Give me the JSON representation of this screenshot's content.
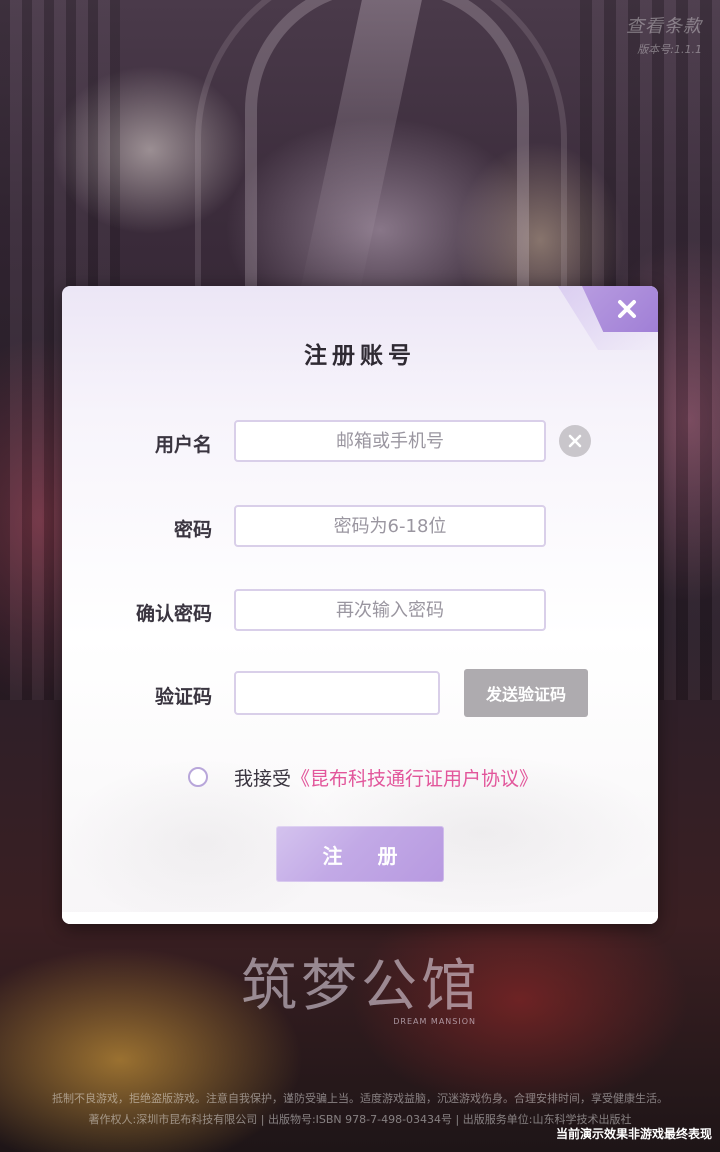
{
  "top_right": {
    "terms_label": "查看条款",
    "version": "版本号:1.1.1"
  },
  "dialog": {
    "title": "注册账号",
    "close_icon": "close-icon",
    "username": {
      "label": "用户名",
      "placeholder": "邮箱或手机号",
      "value": ""
    },
    "password": {
      "label": "密码",
      "placeholder": "密码为6-18位",
      "value": ""
    },
    "confirm_password": {
      "label": "确认密码",
      "placeholder": "再次输入密码",
      "value": ""
    },
    "verification": {
      "label": "验证码",
      "value": "",
      "send_button": "发送验证码"
    },
    "agreement": {
      "prefix": "我接受",
      "link": "《昆布科技通行证用户协议》",
      "checked": false
    },
    "register_button": "注 册"
  },
  "branding": {
    "logo_text": "筑梦公馆",
    "logo_subtitle": "DREAM MANSION"
  },
  "footer": {
    "notice_line1": "抵制不良游戏，拒绝盗版游戏。注意自我保护，谨防受骗上当。适度游戏益脑，沉迷游戏伤身。合理安排时间，享受健康生活。",
    "notice_line2": "著作权人:深圳市昆布科技有限公司 | 出版物号:ISBN 978-7-498-03434号 | 出版服务单位:山东科学技术出版社",
    "demo_note": "当前演示效果非游戏最终表现"
  },
  "colors": {
    "accent": "#b799e0",
    "link": "#e2569b",
    "send_button_bg": "#aeabaf"
  }
}
